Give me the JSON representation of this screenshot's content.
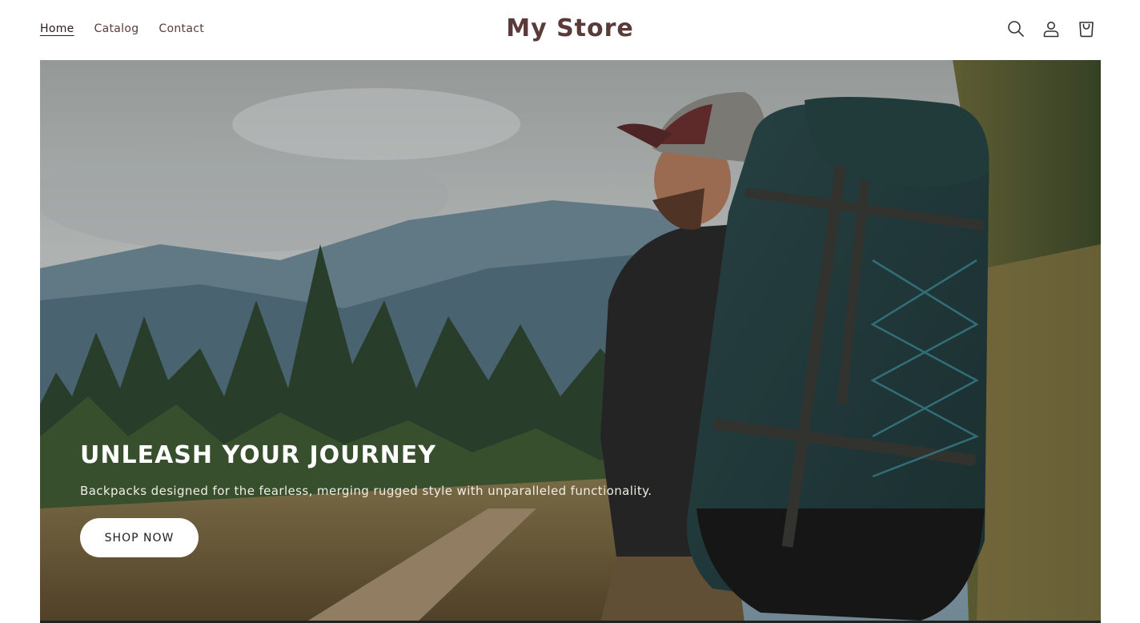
{
  "header": {
    "nav": [
      {
        "label": "Home",
        "active": true
      },
      {
        "label": "Catalog",
        "active": false
      },
      {
        "label": "Contact",
        "active": false
      }
    ],
    "store_name": "My Store",
    "icons": [
      "search-icon",
      "account-icon",
      "cart-icon"
    ]
  },
  "hero": {
    "title": "UNLEASH YOUR JOURNEY",
    "subtitle": "Backpacks designed for the fearless, merging rugged style with unparalleled functionality.",
    "cta_label": "SHOP NOW"
  },
  "colors": {
    "brand": "#5b3a3a",
    "button_bg": "#ffffff",
    "button_text": "#1d1d1d"
  }
}
